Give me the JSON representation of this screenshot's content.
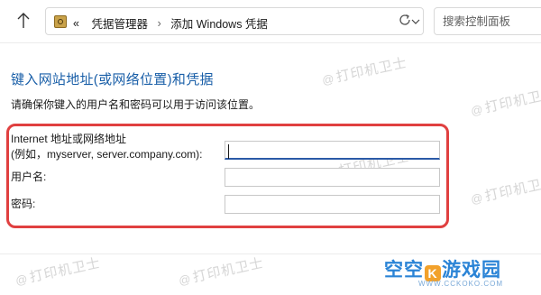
{
  "breadcrumb": {
    "overflow": "«",
    "parent": "凭据管理器",
    "separator": "›",
    "current": "添加 Windows 凭据"
  },
  "search": {
    "placeholder": "搜索控制面板"
  },
  "form": {
    "heading": "键入网站地址(或网络位置)和凭据",
    "description": "请确保你键入的用户名和密码可以用于访问该位置。",
    "address_label_line1": "Internet 地址或网络地址",
    "address_label_line2": "(例如，myserver, server.company.com):",
    "address_value": "",
    "username_label": "用户名:",
    "username_value": "",
    "password_label": "密码:",
    "password_value": ""
  },
  "watermark": {
    "text": "打印机卫士"
  },
  "brand": {
    "name_part1": "空空",
    "name_part2": "游戏园",
    "mark": "K",
    "url": "WWW.CCKOKO.COM"
  },
  "colors": {
    "heading": "#1a5fa8",
    "highlight": "#e04040",
    "brand": "#2b84d6",
    "brand_accent": "#f2a12b"
  }
}
